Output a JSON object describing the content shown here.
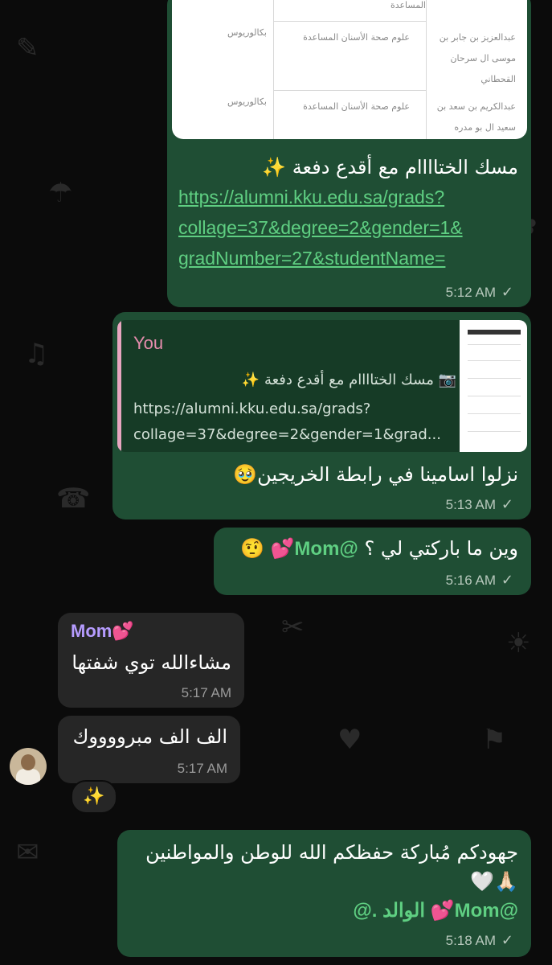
{
  "chat": {
    "msg1": {
      "table_rows": [
        {
          "name": "المساعدة",
          "col2": "",
          "col3": ""
        },
        {
          "name": "عبدالعزيز بن جابر بن موسى ال سرحان القحطاني",
          "col2": "علوم صحة الأسنان المساعدة",
          "col3": "بكالوريوس"
        },
        {
          "name": "عبدالكريم بن سعد بن سعيد ال بو مدره",
          "col2": "علوم صحة الأسنان المساعدة",
          "col3": "بكالوريوس"
        }
      ],
      "caption": "مسك الختاااام مع أقدع دفعة ✨",
      "link_lines": [
        "https://alumni.kku.edu.sa/grads?",
        "collage=37&degree=2&gender=1&",
        "gradNumber=27&studentName="
      ],
      "time": "5:12 AM"
    },
    "msg2": {
      "quote_author": "You",
      "quote_line1": "📷 مسك الختاااام مع أقدع دفعة ✨",
      "quote_line2": "https://alumni.kku.edu.sa/grads?",
      "quote_line3": "collage=37&degree=2&gender=1&grad...",
      "text": "نزلوا اسامينا في رابطة الخريجين🥹",
      "time": "5:13 AM"
    },
    "msg3": {
      "text": "وين ما باركتي لي ؟",
      "mention": "@Mom💕",
      "emoji": "🤨",
      "time": "5:16 AM"
    },
    "msg4": {
      "sender": "Mom💕",
      "text": "مشاءالله توي شفتها",
      "time": "5:17 AM"
    },
    "msg5": {
      "text": "الف الف مبرووووك",
      "time": "5:17 AM",
      "reaction": "✨"
    },
    "msg6": {
      "text": "جهودكم مُباركة حفظكم الله للوطن والمواطنين",
      "emojis": "🙏🏻🤍",
      "mention_line": "@Mom💕 الوالد .@",
      "time": "5:18 AM"
    }
  },
  "colors": {
    "outgoing_bubble": "#1f4e34",
    "incoming_bubble": "#262626",
    "link": "#5fcf82",
    "background": "#0b0b0b"
  },
  "icons": [
    "camera-icon",
    "read-check-icon",
    "avatar-photo"
  ]
}
